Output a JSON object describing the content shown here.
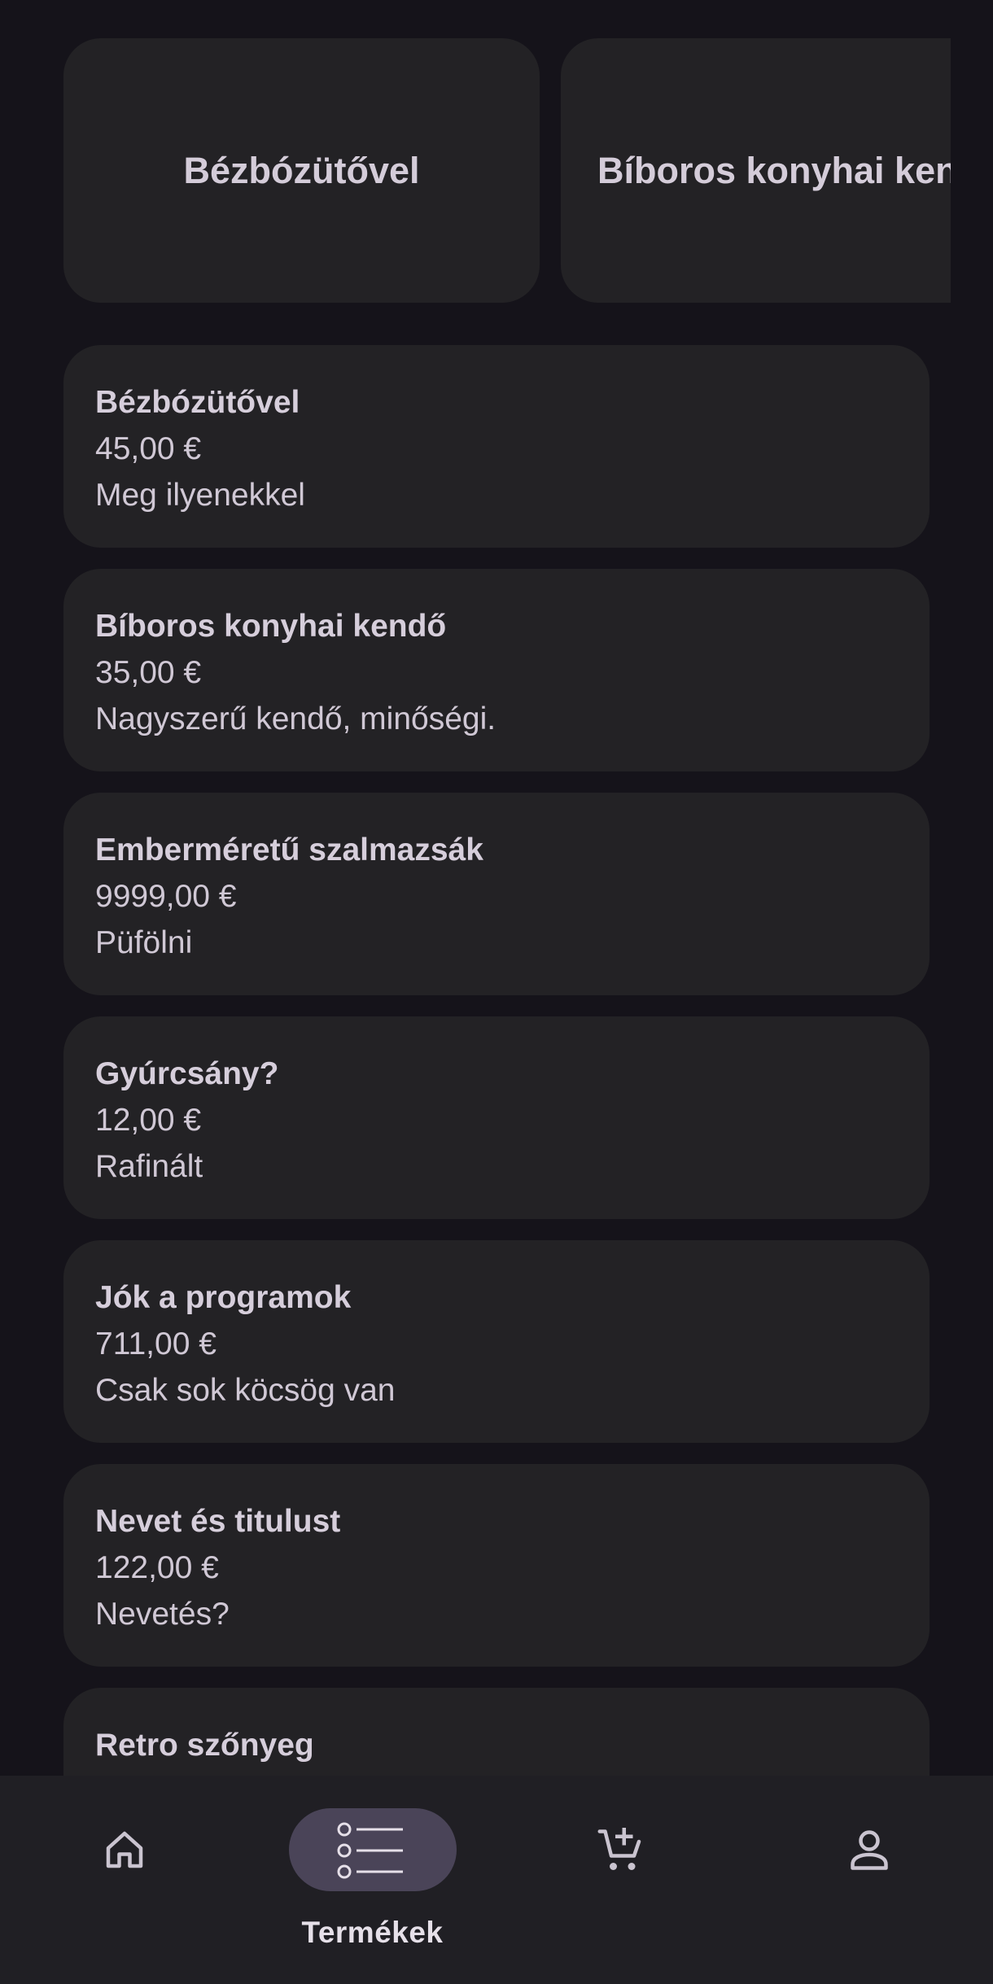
{
  "featured": [
    {
      "title": "Bézbózütővel"
    },
    {
      "title": "Bíboros konyhai kendő"
    }
  ],
  "products": [
    {
      "name": "Bézbózütővel",
      "price": "45,00 €",
      "description": "Meg ilyenekkel"
    },
    {
      "name": "Bíboros konyhai kendő",
      "price": "35,00 €",
      "description": "Nagyszerű kendő, minőségi."
    },
    {
      "name": "Emberméretű szalmazsák",
      "price": "9999,00 €",
      "description": "Püfölni"
    },
    {
      "name": "Gyúrcsány?",
      "price": "12,00 €",
      "description": "Rafinált"
    },
    {
      "name": "Jók a programok",
      "price": "711,00 €",
      "description": "Csak sok köcsög van"
    },
    {
      "name": "Nevet és titulust",
      "price": "122,00 €",
      "description": "Nevetés?"
    },
    {
      "name": "Retro szőnyeg",
      "price": "",
      "description": ""
    }
  ],
  "nav": {
    "items": [
      {
        "id": "home",
        "icon": "home-icon",
        "label": ""
      },
      {
        "id": "products",
        "icon": "list-icon",
        "label": "Termékek",
        "active": true
      },
      {
        "id": "cart",
        "icon": "cart-add-icon",
        "label": ""
      },
      {
        "id": "profile",
        "icon": "person-icon",
        "label": ""
      }
    ]
  },
  "colors": {
    "background": "#15131a",
    "card": "#232225",
    "nav_bar": "#201f24",
    "active_indicator": "#4a4458",
    "text": "#d4ccd9"
  }
}
